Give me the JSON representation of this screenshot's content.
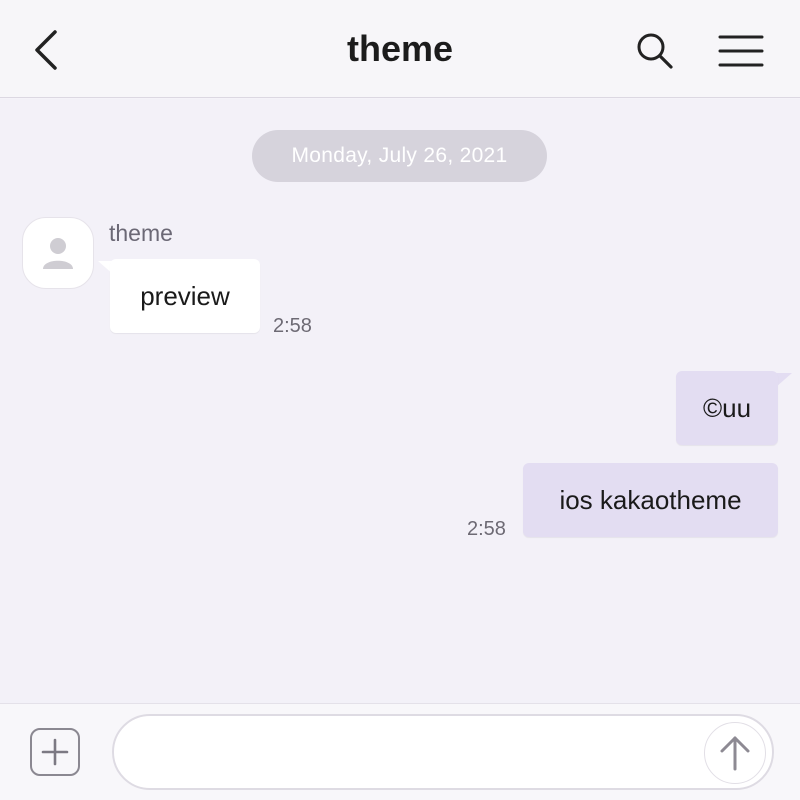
{
  "header": {
    "title": "theme",
    "back_icon": "chevron-left-icon",
    "search_icon": "search-icon",
    "menu_icon": "hamburger-menu-icon"
  },
  "chat": {
    "date_separator": "Monday, July 26, 2021",
    "incoming": {
      "sender": "theme",
      "avatar_icon": "user-silhouette-icon",
      "messages": [
        {
          "text": "preview",
          "time": "2:58"
        }
      ]
    },
    "outgoing": {
      "messages": [
        {
          "text": "©uu"
        },
        {
          "text": "ios kakaotheme",
          "time": "2:58"
        }
      ]
    },
    "colors": {
      "background": "#f3f1f8",
      "incoming_bubble": "#ffffff",
      "outgoing_bubble": "#e3ddf2",
      "date_pill": "#d6d3dc"
    }
  },
  "composer": {
    "plus_icon": "plus-square-icon",
    "input_value": "",
    "send_icon": "arrow-up-icon"
  }
}
